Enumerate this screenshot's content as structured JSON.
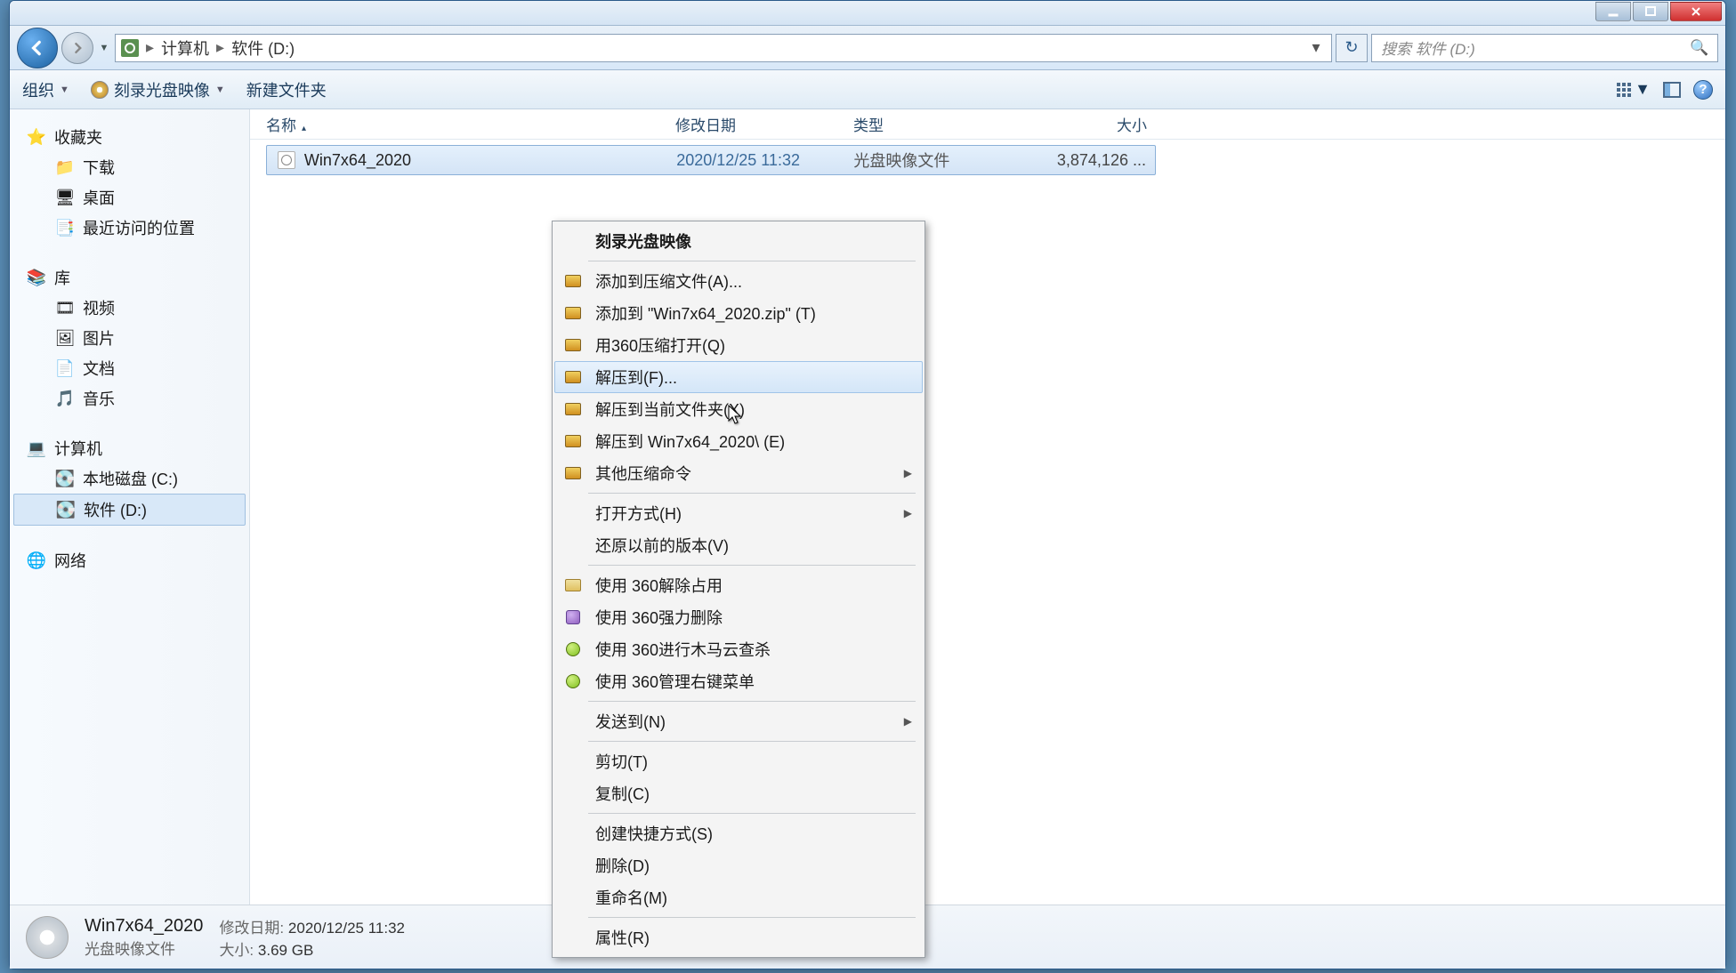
{
  "breadcrumb": {
    "computer": "计算机",
    "drive": "软件 (D:)"
  },
  "search": {
    "placeholder": "搜索 软件 (D:)"
  },
  "toolbar": {
    "organize": "组织",
    "burn": "刻录光盘映像",
    "newfolder": "新建文件夹"
  },
  "sidebar": {
    "favorites": {
      "label": "收藏夹",
      "items": [
        "下载",
        "桌面",
        "最近访问的位置"
      ]
    },
    "libraries": {
      "label": "库",
      "items": [
        "视频",
        "图片",
        "文档",
        "音乐"
      ]
    },
    "computer": {
      "label": "计算机",
      "items": [
        "本地磁盘 (C:)",
        "软件 (D:)"
      ],
      "selected": 1
    },
    "network": {
      "label": "网络"
    }
  },
  "columns": {
    "name": "名称",
    "date": "修改日期",
    "type": "类型",
    "size": "大小"
  },
  "file": {
    "name": "Win7x64_2020",
    "date": "2020/12/25 11:32",
    "type": "光盘映像文件",
    "size": "3,874,126 ..."
  },
  "context": {
    "burn": "刻录光盘映像",
    "addto_archive": "添加到压缩文件(A)...",
    "addto_zip": "添加到 \"Win7x64_2020.zip\" (T)",
    "open_360zip": "用360压缩打开(Q)",
    "extract_to": "解压到(F)...",
    "extract_here": "解压到当前文件夹(X)",
    "extract_named": "解压到 Win7x64_2020\\ (E)",
    "other_zip": "其他压缩命令",
    "open_with": "打开方式(H)",
    "restore_prev": "还原以前的版本(V)",
    "unlock_360": "使用 360解除占用",
    "force_delete_360": "使用 360强力删除",
    "scan_360": "使用 360进行木马云查杀",
    "manage_ctx_360": "使用 360管理右键菜单",
    "send_to": "发送到(N)",
    "cut": "剪切(T)",
    "copy": "复制(C)",
    "create_shortcut": "创建快捷方式(S)",
    "delete": "删除(D)",
    "rename": "重命名(M)",
    "properties": "属性(R)"
  },
  "details": {
    "name": "Win7x64_2020",
    "type": "光盘映像文件",
    "date_label": "修改日期:",
    "date": "2020/12/25 11:32",
    "size_label": "大小:",
    "size": "3.69 GB"
  }
}
